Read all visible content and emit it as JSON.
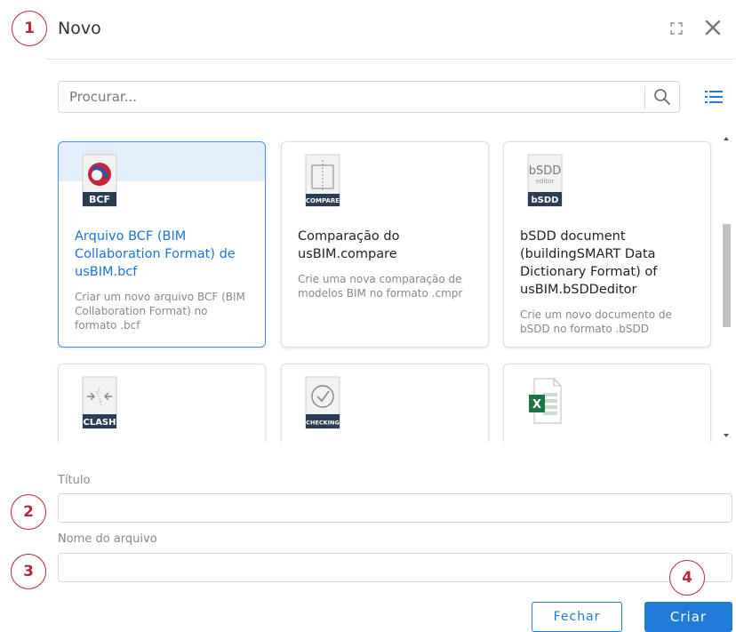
{
  "markers": [
    "1",
    "2",
    "3",
    "4"
  ],
  "dialog": {
    "title": "Novo"
  },
  "search": {
    "placeholder": "Procurar..."
  },
  "templates": [
    {
      "badge": "BCF",
      "name": "Arquivo BCF (BIM Collaboration Format) de usBIM.bcf",
      "description": "Criar um novo arquivo BCF (BIM Collaboration Format) no formato .bcf",
      "selected": true
    },
    {
      "badge": "COMPARE",
      "name": "Comparação do usBIM.compare",
      "description": "Crie uma nova comparação de modelos BIM no formato .cmpr",
      "selected": false
    },
    {
      "badge": "bSDD",
      "logo_text": "bSDD",
      "logo_sub": "editor",
      "name": "bSDD document (buildingSMART Data Dictionary Format) of usBIM.bSDDeditor",
      "description": "Crie um novo documento de bSDD no formato .bSDD",
      "selected": false
    },
    {
      "badge": "CLASH",
      "name": "",
      "description": "",
      "selected": false
    },
    {
      "badge": "CHECKING",
      "name": "",
      "description": "",
      "selected": false
    },
    {
      "badge": "",
      "logo_text": "X",
      "name": "",
      "description": "",
      "selected": false
    }
  ],
  "form": {
    "title_label": "Título",
    "title_value": "",
    "filename_label": "Nome do arquivo",
    "filename_value": ""
  },
  "buttons": {
    "close_label": "Fechar",
    "create_label": "Criar"
  },
  "colors": {
    "accent": "#1f7ad8",
    "marker": "#b5293a",
    "icon_dark": "#2b3c55",
    "excel": "#1f7244"
  }
}
